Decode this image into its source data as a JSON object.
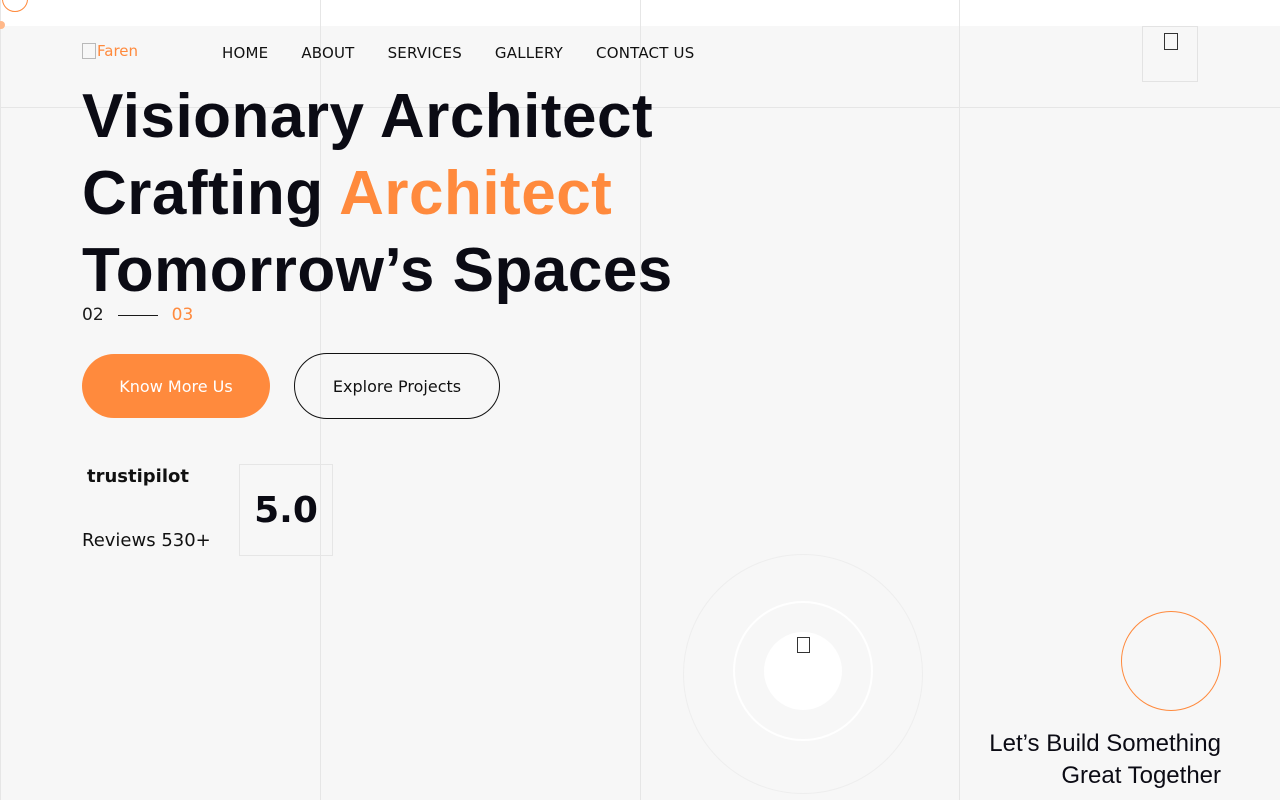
{
  "header": {
    "logo_alt": "Faren",
    "nav": [
      "HOME",
      "ABOUT",
      "SERVICES",
      "GALLERY",
      "CONTACT US"
    ],
    "menu_icon": "hamburger-icon"
  },
  "hero": {
    "title_line1": "Visionary Architect",
    "title_line2_prefix": "Crafting ",
    "title_line2_accent": "Architect",
    "title_line3": "Tomorrow’s Spaces",
    "slide_current": "02",
    "slide_next": "03",
    "primary_button": "Know More Us",
    "secondary_button": "Explore Projects"
  },
  "reviews": {
    "brand": "trustipilot",
    "label": "Reviews 530+",
    "rating": "5.0"
  },
  "video": {
    "icon": "play-icon"
  },
  "cta": {
    "line1": "Let’s Build Something",
    "line2": "Great Together"
  },
  "colors": {
    "accent": "#ff8a3d",
    "text": "#0b0b14",
    "background": "#f7f7f7"
  }
}
